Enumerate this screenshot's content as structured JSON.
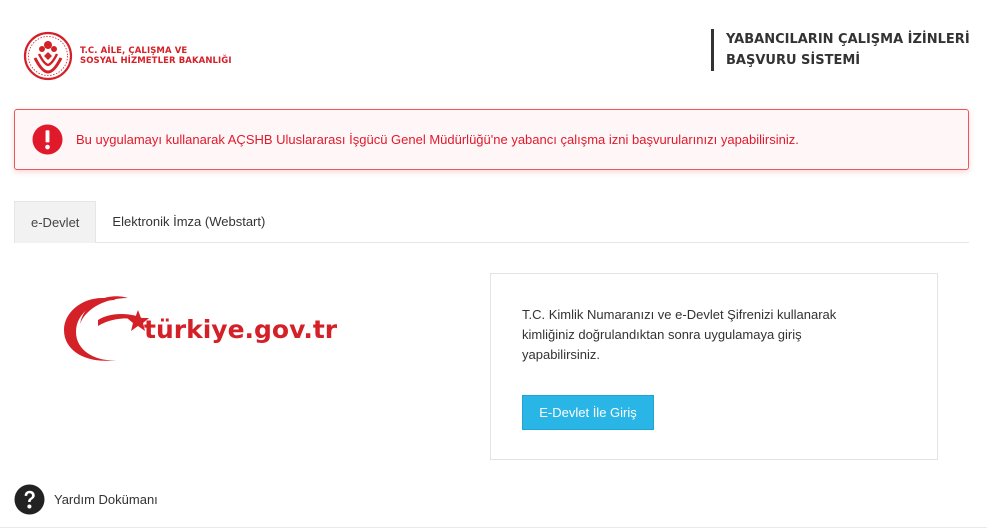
{
  "header": {
    "ministry_line1": "T.C. AİLE, ÇALIŞMA VE",
    "ministry_line2": "SOSYAL HİZMETLER BAKANLIĞI",
    "system_title_line1": "YABANCILARIN ÇALIŞMA İZİNLERİ",
    "system_title_line2": "BAŞVURU SİSTEMİ"
  },
  "alert": {
    "icon": "exclamation-circle-icon",
    "text": "Bu uygulamayı kullanarak AÇSHB Uluslararası İşgücü Genel Müdürlüğü'ne yabancı çalışma izni başvurularınızı yapabilirsiniz."
  },
  "tabs": [
    {
      "label": "e-Devlet",
      "active": true
    },
    {
      "label": "Elektronik İmza (Webstart)",
      "active": false
    }
  ],
  "edevlet": {
    "logo_text": "türkiye.gov.tr",
    "description": "T.C. Kimlik Numaranızı ve e-Devlet Şifrenizi kullanarak kimliğiniz doğrulandıktan sonra uygulamaya giriş yapabilirsiniz.",
    "login_button": "E-Devlet İle Giriş"
  },
  "help": {
    "icon": "question-circle-icon",
    "label": "Yardım Dokümanı"
  },
  "colors": {
    "brand_red": "#d42027",
    "alert_text": "#e0192b",
    "button_blue": "#29b6e6"
  }
}
